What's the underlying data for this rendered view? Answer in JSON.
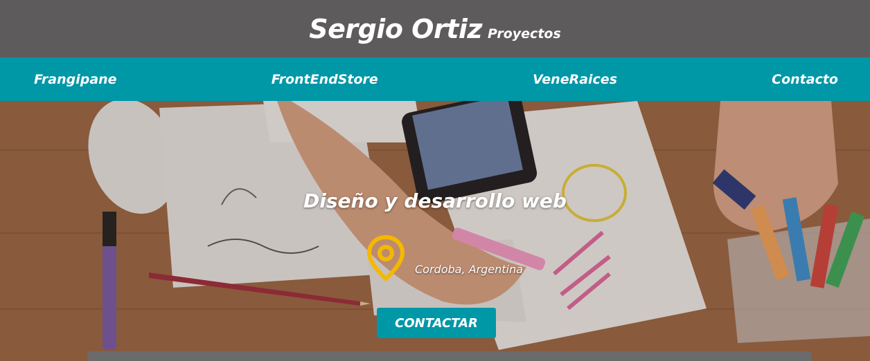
{
  "header": {
    "name": "Sergio Ortiz",
    "subtitle": "Proyectos"
  },
  "nav": {
    "items": [
      {
        "label": "Frangipane"
      },
      {
        "label": "FrontEndStore"
      },
      {
        "label": "VeneRaices"
      },
      {
        "label": "Contacto"
      }
    ]
  },
  "hero": {
    "title": "Diseño y desarrollo web",
    "location": "Cordoba, Argentina",
    "cta_label": "CONTACTAR",
    "pin_icon": "location-pin-icon"
  },
  "colors": {
    "header_bg": "#5e5b5c",
    "nav_bg": "#0097a7",
    "accent_yellow": "#f5b800"
  }
}
